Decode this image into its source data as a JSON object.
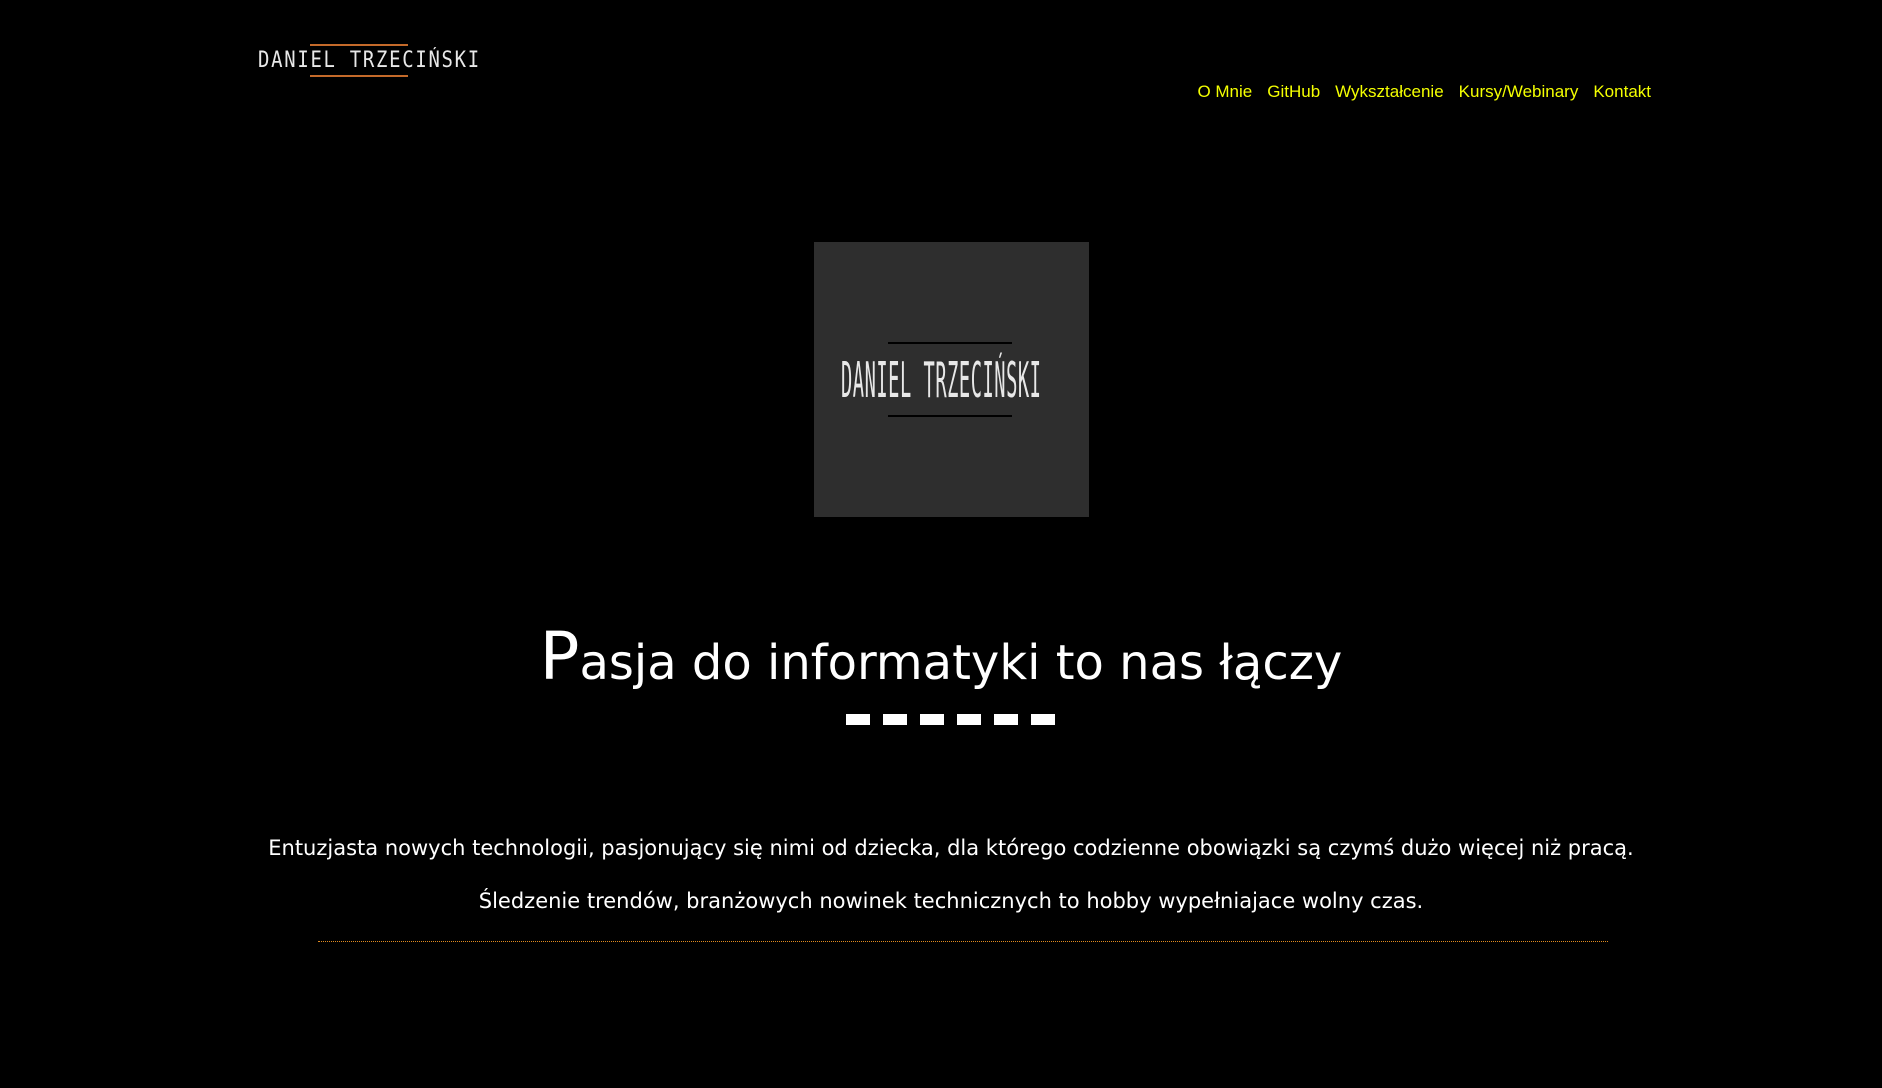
{
  "header": {
    "logo_text": "DANIEL TRZECIŃSKI"
  },
  "nav": {
    "items": [
      "O Mnie",
      "GitHub",
      "Wykształcenie",
      "Kursy/Webinary",
      "Kontakt"
    ]
  },
  "center_logo": {
    "text": "DANIEL TRZECIŃSKI"
  },
  "hero": {
    "headline_first": "P",
    "headline_rest": "asja do informatyki to nas łączy"
  },
  "about": {
    "paragraph_1": "Entuzjasta nowych technologii, pasjonujący się nimi od dziecka, dla którego codzienne obowiązki są czymś dużo więcej niż pracą.",
    "paragraph_2": "Śledzenie trendów, branżowych nowinek technicznych to hobby wypełniajace wolny czas."
  },
  "colors": {
    "background": "#000000",
    "nav_link": "#f4ff00",
    "accent_line": "#c46a2a",
    "logo_box": "#2e2e2e",
    "divider": "#e08a20"
  }
}
